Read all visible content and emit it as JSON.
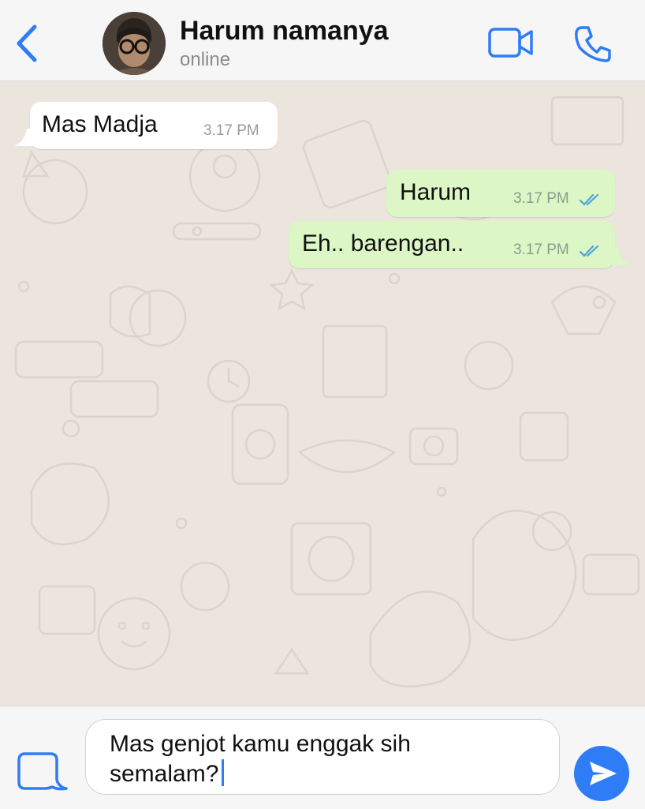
{
  "header": {
    "contact_name": "Harum namanya",
    "status": "online"
  },
  "messages": [
    {
      "direction": "incoming",
      "text": "Mas Madja",
      "time": "3.17 PM"
    },
    {
      "direction": "outgoing",
      "text": "Harum",
      "time": "3.17 PM",
      "status": "read"
    },
    {
      "direction": "outgoing",
      "text": "Eh.. barengan..",
      "time": "3.17 PM",
      "status": "read"
    }
  ],
  "composer": {
    "line1": "Mas genjot kamu enggak sih",
    "line2": "semalam?"
  },
  "icons": {
    "back": "chevron-left-icon",
    "video": "video-camera-icon",
    "call": "phone-icon",
    "attach": "sticker-icon",
    "send": "send-icon"
  },
  "colors": {
    "accent": "#2e7cf6",
    "outgoing_bubble": "#dcf7c5",
    "incoming_bubble": "#ffffff",
    "chat_background": "#ece5dd",
    "read_ticks": "#4fa3e0"
  }
}
